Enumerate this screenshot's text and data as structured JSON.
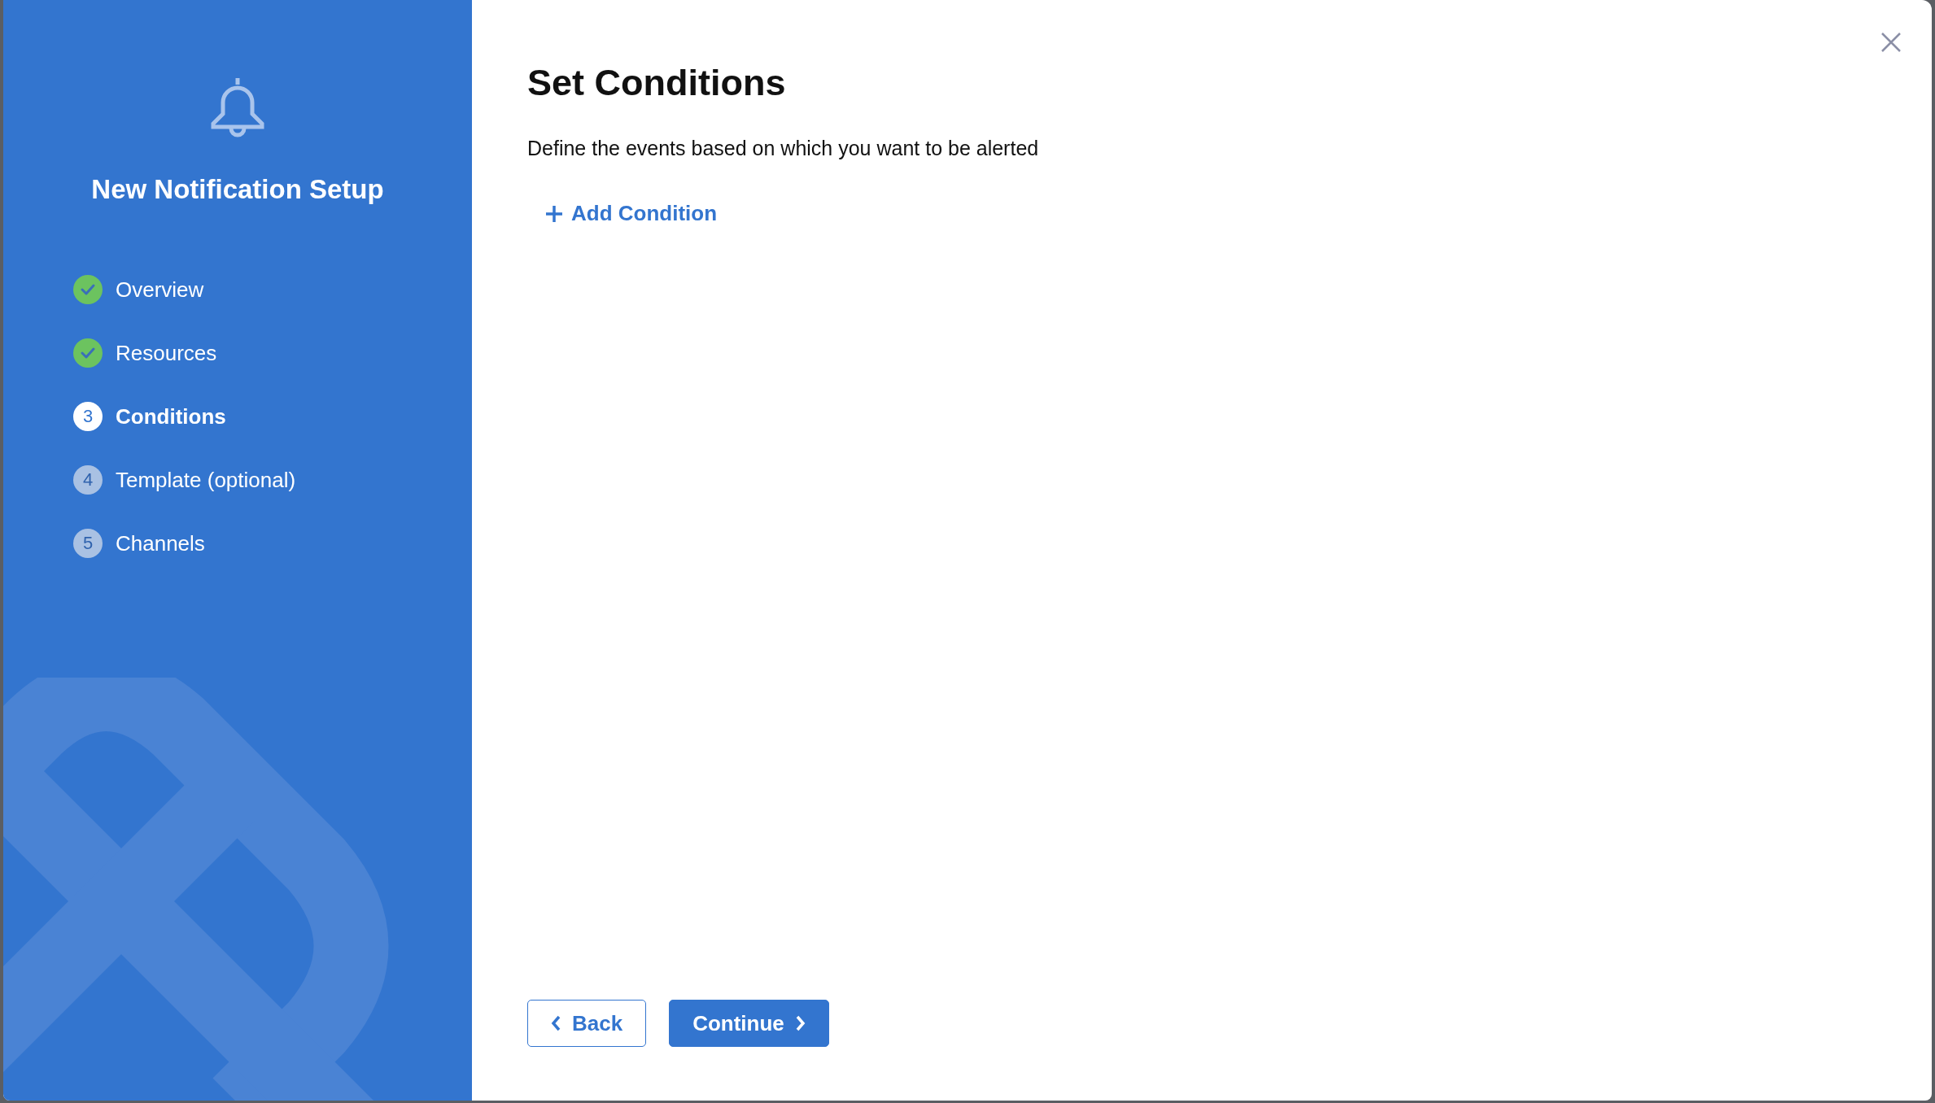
{
  "sidebar": {
    "title": "New Notification Setup",
    "steps": [
      {
        "label": "Overview",
        "completed": true,
        "selected": false
      },
      {
        "label": "Resources",
        "completed": true,
        "selected": false
      },
      {
        "number": "3",
        "label": "Conditions",
        "completed": false,
        "selected": true
      },
      {
        "number": "4",
        "label": "Template (optional)",
        "completed": false,
        "selected": false
      },
      {
        "number": "5",
        "label": "Channels",
        "completed": false,
        "selected": false
      }
    ]
  },
  "main": {
    "title": "Set Conditions",
    "description": "Define the events based on which you want to be alerted",
    "add_button": "Add Condition"
  },
  "footer": {
    "back_button": "Back",
    "continue_button": "Continue"
  }
}
